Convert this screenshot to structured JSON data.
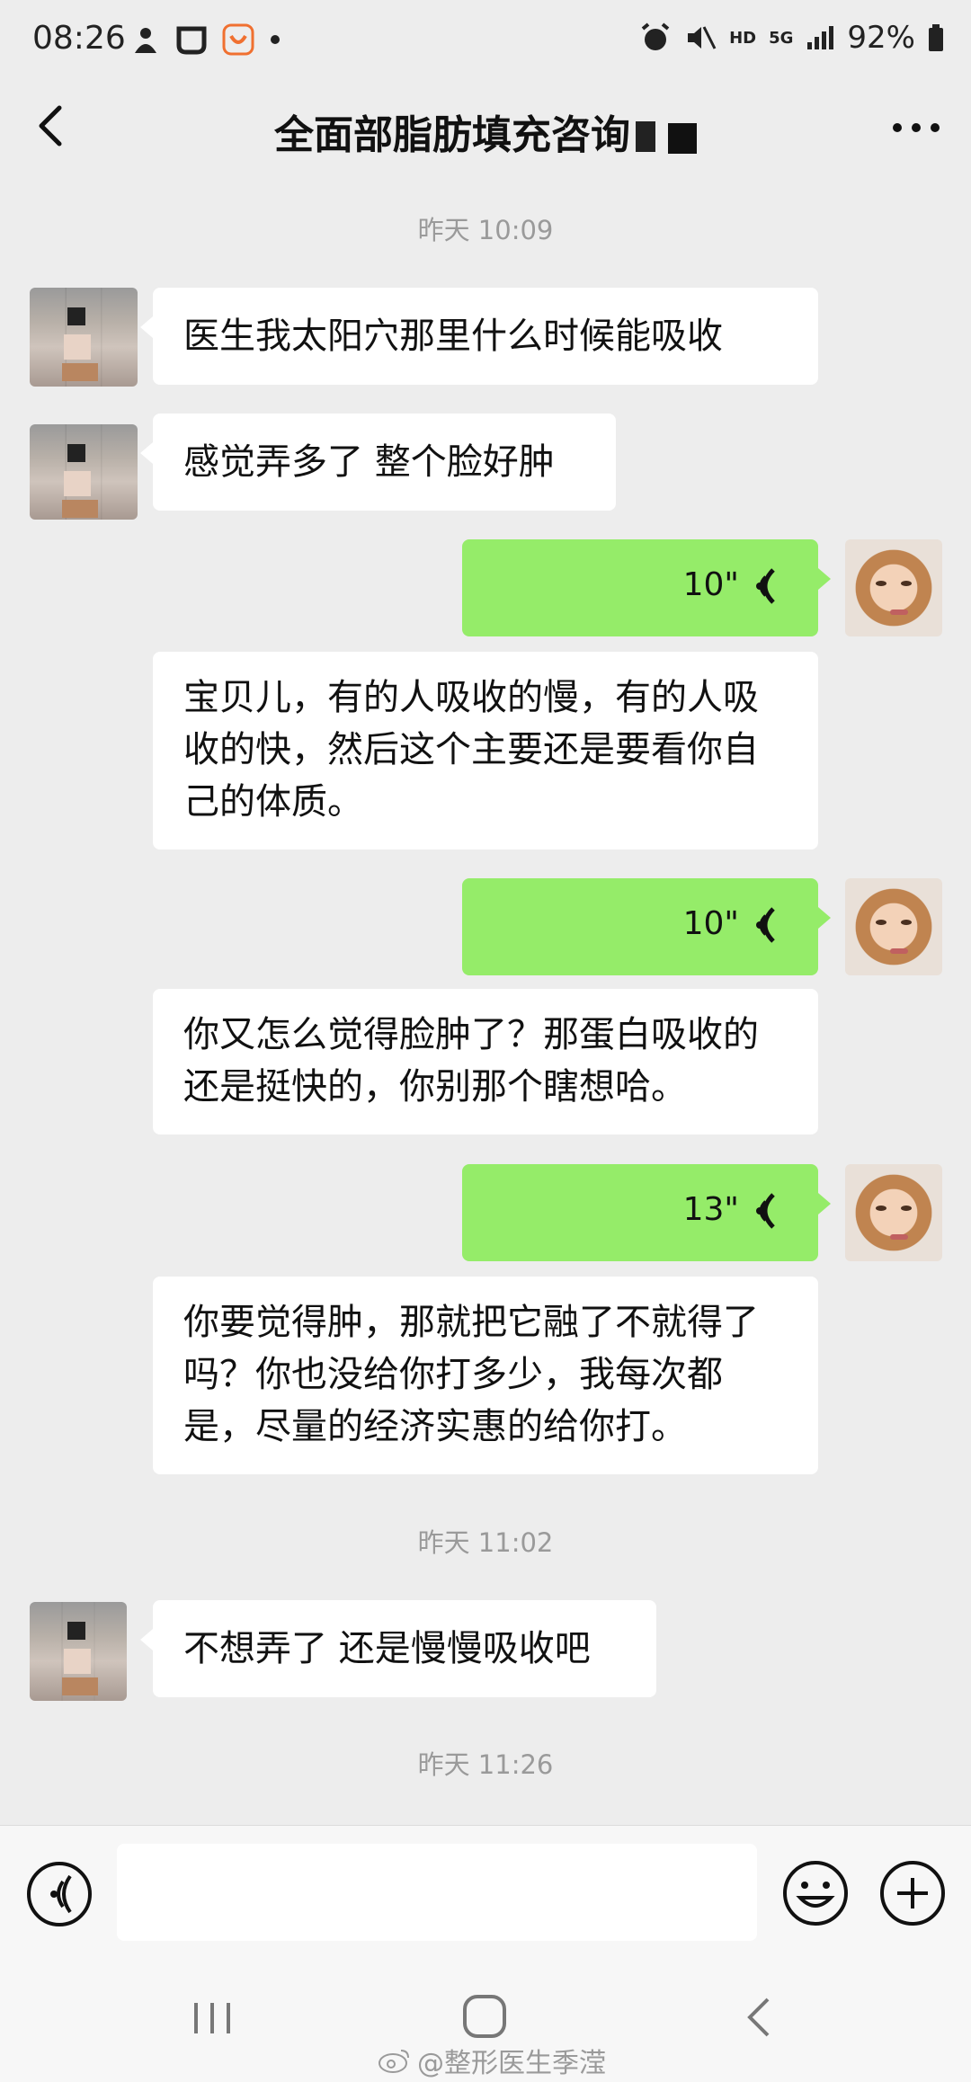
{
  "status_bar": {
    "time": "08:26",
    "network_hd": "HD",
    "network_5g": "5G",
    "battery": "92%"
  },
  "header": {
    "title": "全面部脂肪填充咨询"
  },
  "colors": {
    "background": "#ededed",
    "bubble_received": "#ffffff",
    "bubble_sent_voice": "#95ec69",
    "timestamp_text": "#9a9a9a"
  },
  "timestamps": [
    "昨天 10:09",
    "昨天 11:02",
    "昨天 11:26"
  ],
  "messages": [
    {
      "side": "left",
      "type": "text",
      "text": "医生我太阳穴那里什么时候能吸收"
    },
    {
      "side": "left",
      "type": "text",
      "text": "感觉弄多了 整个脸好肿"
    },
    {
      "side": "right",
      "type": "voice",
      "duration": "10\""
    },
    {
      "side": "right",
      "type": "text",
      "text": "宝贝儿，有的人吸收的慢，有的人吸收的快，然后这个主要还是要看你自己的体质。"
    },
    {
      "side": "right",
      "type": "voice",
      "duration": "10\""
    },
    {
      "side": "right",
      "type": "text",
      "text": "你又怎么觉得脸肿了？那蛋白吸收的还是挺快的，你别那个瞎想哈。"
    },
    {
      "side": "right",
      "type": "voice",
      "duration": "13\""
    },
    {
      "side": "right",
      "type": "text",
      "text": "你要觉得肿，那就把它融了不就得了吗？你也没给你打多少，我每次都是，尽量的经济实惠的给你打。"
    },
    {
      "side": "left",
      "type": "text",
      "text": "不想弄了 还是慢慢吸收吧"
    }
  ],
  "input_bar": {
    "voice_icon": "voice-input-icon",
    "emoji_icon": "emoji-icon",
    "plus_icon": "plus-icon"
  },
  "watermark": "@整形医生季滢"
}
